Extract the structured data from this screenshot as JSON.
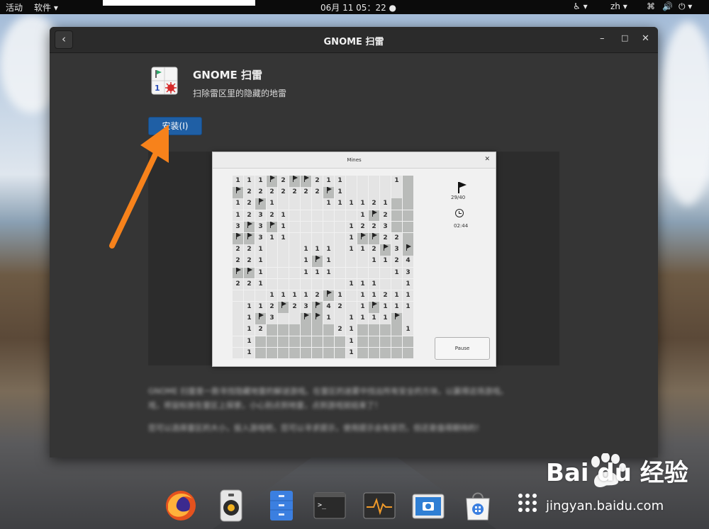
{
  "topbar": {
    "activities": "活动",
    "app_menu": "软件 ▾",
    "clock": "06月 11 05：22 ●",
    "lang": "zh ▾"
  },
  "window": {
    "title": "GNOME 扫雷",
    "back": "‹",
    "minimize": "–",
    "maximize": "□",
    "close": "✕"
  },
  "app": {
    "name": "GNOME 扫雷",
    "description": "扫除雷区里的隐藏的地雷",
    "install_label": "安装(I)"
  },
  "screenshot": {
    "title": "Mines",
    "close": "✕",
    "flag_count": "29/40",
    "time": "02:44",
    "pause_label": "Pause",
    "rows": [
      "111F2FF211    1UU",
      "F2222222F1     UU",
      "12F1    111121UU",
      "12321      1F2UU",
      "3F3F1     1223UU",
      "FF311     1FF22UU",
      "221   111 112F3FF",
      "221   1F1   1124F",
      "FF1   111     13F",
      "221       111  1F2",
      "   11112F1 11211",
      " 112F23F42 1F111",
      " 1F3  FF1 1111F",
      " 12UUUUUU21UUUU11",
      " 1UUUUUUUU1UUUUUU",
      " 1UUUUUUUU1UUUUUU"
    ]
  },
  "blurred_description": [
    "GNOME 扫雷是一款寻找隐藏地雷的解谜游戏。在雷区的迷雾中找出所有安全的方块，以赢得这场游戏。",
    "戏，将鼠标放在雷区上探索，小心别点到地雷，点到游戏就结束了！",
    "您可以选择雷区的大小，投入游戏吧，您可以寻求提示，使用提示会有惩罚，但还是值得期待的！"
  ],
  "dock": {
    "icons": [
      "firefox-icon",
      "rhythmbox-icon",
      "files-icon",
      "terminal-icon",
      "system-monitor-icon",
      "screenshot-icon",
      "software-icon",
      "app-grid-icon"
    ]
  },
  "watermark": {
    "brand": "Bai du 经验",
    "url": "jingyan.baidu.com"
  }
}
